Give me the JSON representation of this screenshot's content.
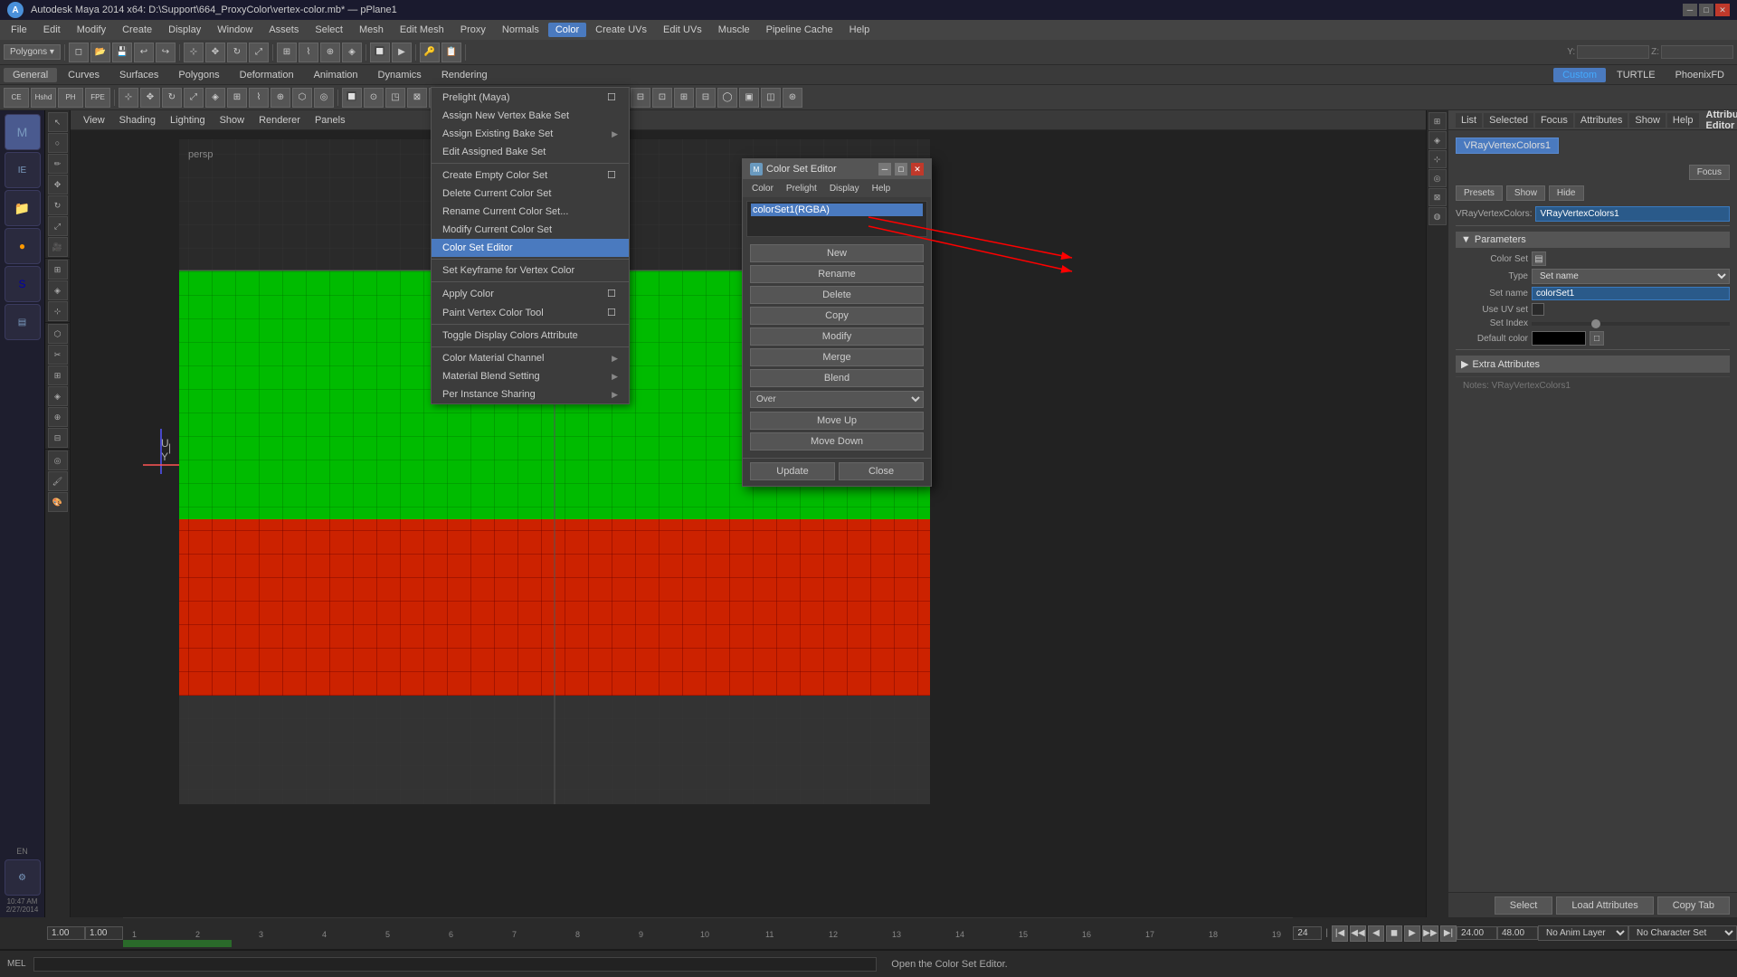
{
  "titlebar": {
    "app_icon": "A",
    "title": "Autodesk Maya 2014 x64: D:\\Support\\664_ProxyColor\\vertex-color.mb* — pPlane1",
    "close": "✕",
    "minimize": "─",
    "maximize": "□"
  },
  "menubar": {
    "items": [
      "File",
      "Edit",
      "Modify",
      "Create",
      "Display",
      "Window",
      "Assets",
      "Select",
      "Mesh",
      "Edit Mesh",
      "Proxy",
      "Normals",
      "Color",
      "Create UVs",
      "Edit UVs",
      "Muscle",
      "Pipeline Cache",
      "Help"
    ]
  },
  "module_tabs": {
    "tabs": [
      "General",
      "Curves",
      "Surfaces",
      "Polygons",
      "Deformation",
      "Animation",
      "Dynamics",
      "Rendering"
    ],
    "active": "General"
  },
  "coord_bar": {
    "y_label": "Y:",
    "z_label": "Z:"
  },
  "viewport_menu": {
    "items": [
      "View",
      "Shading",
      "Lighting",
      "Show",
      "Renderer",
      "Panels"
    ]
  },
  "color_menu": {
    "title": "Color",
    "items": [
      {
        "label": "Prelight (Maya)",
        "has_checkbox": true,
        "submenu": false,
        "highlighted": false
      },
      {
        "label": "Assign New Vertex Bake Set",
        "has_checkbox": false,
        "submenu": false,
        "highlighted": false
      },
      {
        "label": "Assign Existing Bake Set",
        "has_checkbox": false,
        "submenu": true,
        "highlighted": false
      },
      {
        "label": "Edit Assigned Bake Set",
        "has_checkbox": false,
        "submenu": false,
        "highlighted": false
      },
      {
        "separator": true
      },
      {
        "label": "Create Empty Color Set",
        "has_checkbox": true,
        "submenu": false,
        "highlighted": false
      },
      {
        "label": "Delete Current Color Set",
        "has_checkbox": false,
        "submenu": false,
        "highlighted": false
      },
      {
        "label": "Rename Current Color Set...",
        "has_checkbox": false,
        "submenu": false,
        "highlighted": false
      },
      {
        "label": "Modify Current Color Set",
        "has_checkbox": false,
        "submenu": false,
        "highlighted": false
      },
      {
        "label": "Color Set Editor",
        "has_checkbox": false,
        "submenu": false,
        "highlighted": true
      },
      {
        "separator": true
      },
      {
        "label": "Set Keyframe for Vertex Color",
        "has_checkbox": false,
        "submenu": false,
        "highlighted": false
      },
      {
        "separator": true
      },
      {
        "label": "Apply Color",
        "has_checkbox": true,
        "submenu": false,
        "highlighted": false
      },
      {
        "label": "Paint Vertex Color Tool",
        "has_checkbox": true,
        "submenu": false,
        "highlighted": false
      },
      {
        "separator": true
      },
      {
        "label": "Toggle Display Colors Attribute",
        "has_checkbox": false,
        "submenu": false,
        "highlighted": false
      },
      {
        "separator": true
      },
      {
        "label": "Color Material Channel",
        "has_checkbox": false,
        "submenu": true,
        "highlighted": false
      },
      {
        "label": "Material Blend Setting",
        "has_checkbox": false,
        "submenu": true,
        "highlighted": false
      },
      {
        "label": "Per Instance Sharing",
        "has_checkbox": false,
        "submenu": true,
        "highlighted": false
      }
    ]
  },
  "color_set_editor": {
    "title": "Color Set Editor",
    "menus": [
      "Color",
      "Prelight",
      "Display",
      "Help"
    ],
    "list_item": "colorSet1(RGBA)",
    "buttons": {
      "new": "New",
      "rename": "Rename",
      "delete": "Delete",
      "copy": "Copy",
      "modify": "Modify",
      "merge": "Merge",
      "blend": "Blend",
      "blend_option": "Over",
      "move_up": "Move Up",
      "move_down": "Move Down",
      "update": "Update",
      "close": "Close"
    }
  },
  "attribute_editor": {
    "title": "Attribute Editor",
    "tabs": [
      "List",
      "Selected",
      "Focus",
      "Attributes",
      "Show",
      "Help"
    ],
    "node_tab": "VRayVertexColors1",
    "node_name_label": "VRayVertexColors:",
    "node_name_value": "VRayVertexColors1",
    "focus_btn": "Focus",
    "presets_btn": "Presets",
    "show_btn": "Show",
    "hide_btn": "Hide",
    "parameters_section": "Parameters",
    "params": {
      "color_set_label": "Color Set",
      "type_label": "Type",
      "type_value": "Set name",
      "set_name_label": "Set name",
      "set_name_value": "colorSet1",
      "use_uv_label": "Use UV set",
      "set_index_label": "Set Index",
      "default_color_label": "Default color"
    },
    "extra_attributes": "Extra Attributes",
    "bottom_node": "Notes: VRayVertexColors1"
  },
  "bottom_buttons": {
    "select": "Select",
    "load_attributes": "Load Attributes",
    "copy_tab": "Copy Tab"
  },
  "timeline": {
    "start": "1",
    "end": "24",
    "current": "1",
    "playback_start": "1.00",
    "playback_end": "1.00",
    "range_start": "1",
    "range_end": "24",
    "anim_range_start": "24.00",
    "anim_range_end": "48.00",
    "anim_layer": "No Anim Layer",
    "character": "No Character Set",
    "ticks": [
      "1",
      "",
      "",
      "",
      "",
      "",
      "",
      "",
      "",
      "",
      "",
      "",
      "",
      "",
      "",
      "",
      "",
      "",
      "",
      "",
      "",
      "",
      "",
      ""
    ]
  },
  "status_bar": {
    "mel_label": "MEL",
    "message": "Open the Color Set Editor.",
    "time_display": "10:47 AM",
    "date_display": "2/27/2014"
  },
  "bottom_fields": {
    "field1": "1.00",
    "field2": "1.00",
    "frame_num": "1",
    "frame_end": "24"
  },
  "viewport": {
    "green_region": true,
    "red_region": true
  }
}
